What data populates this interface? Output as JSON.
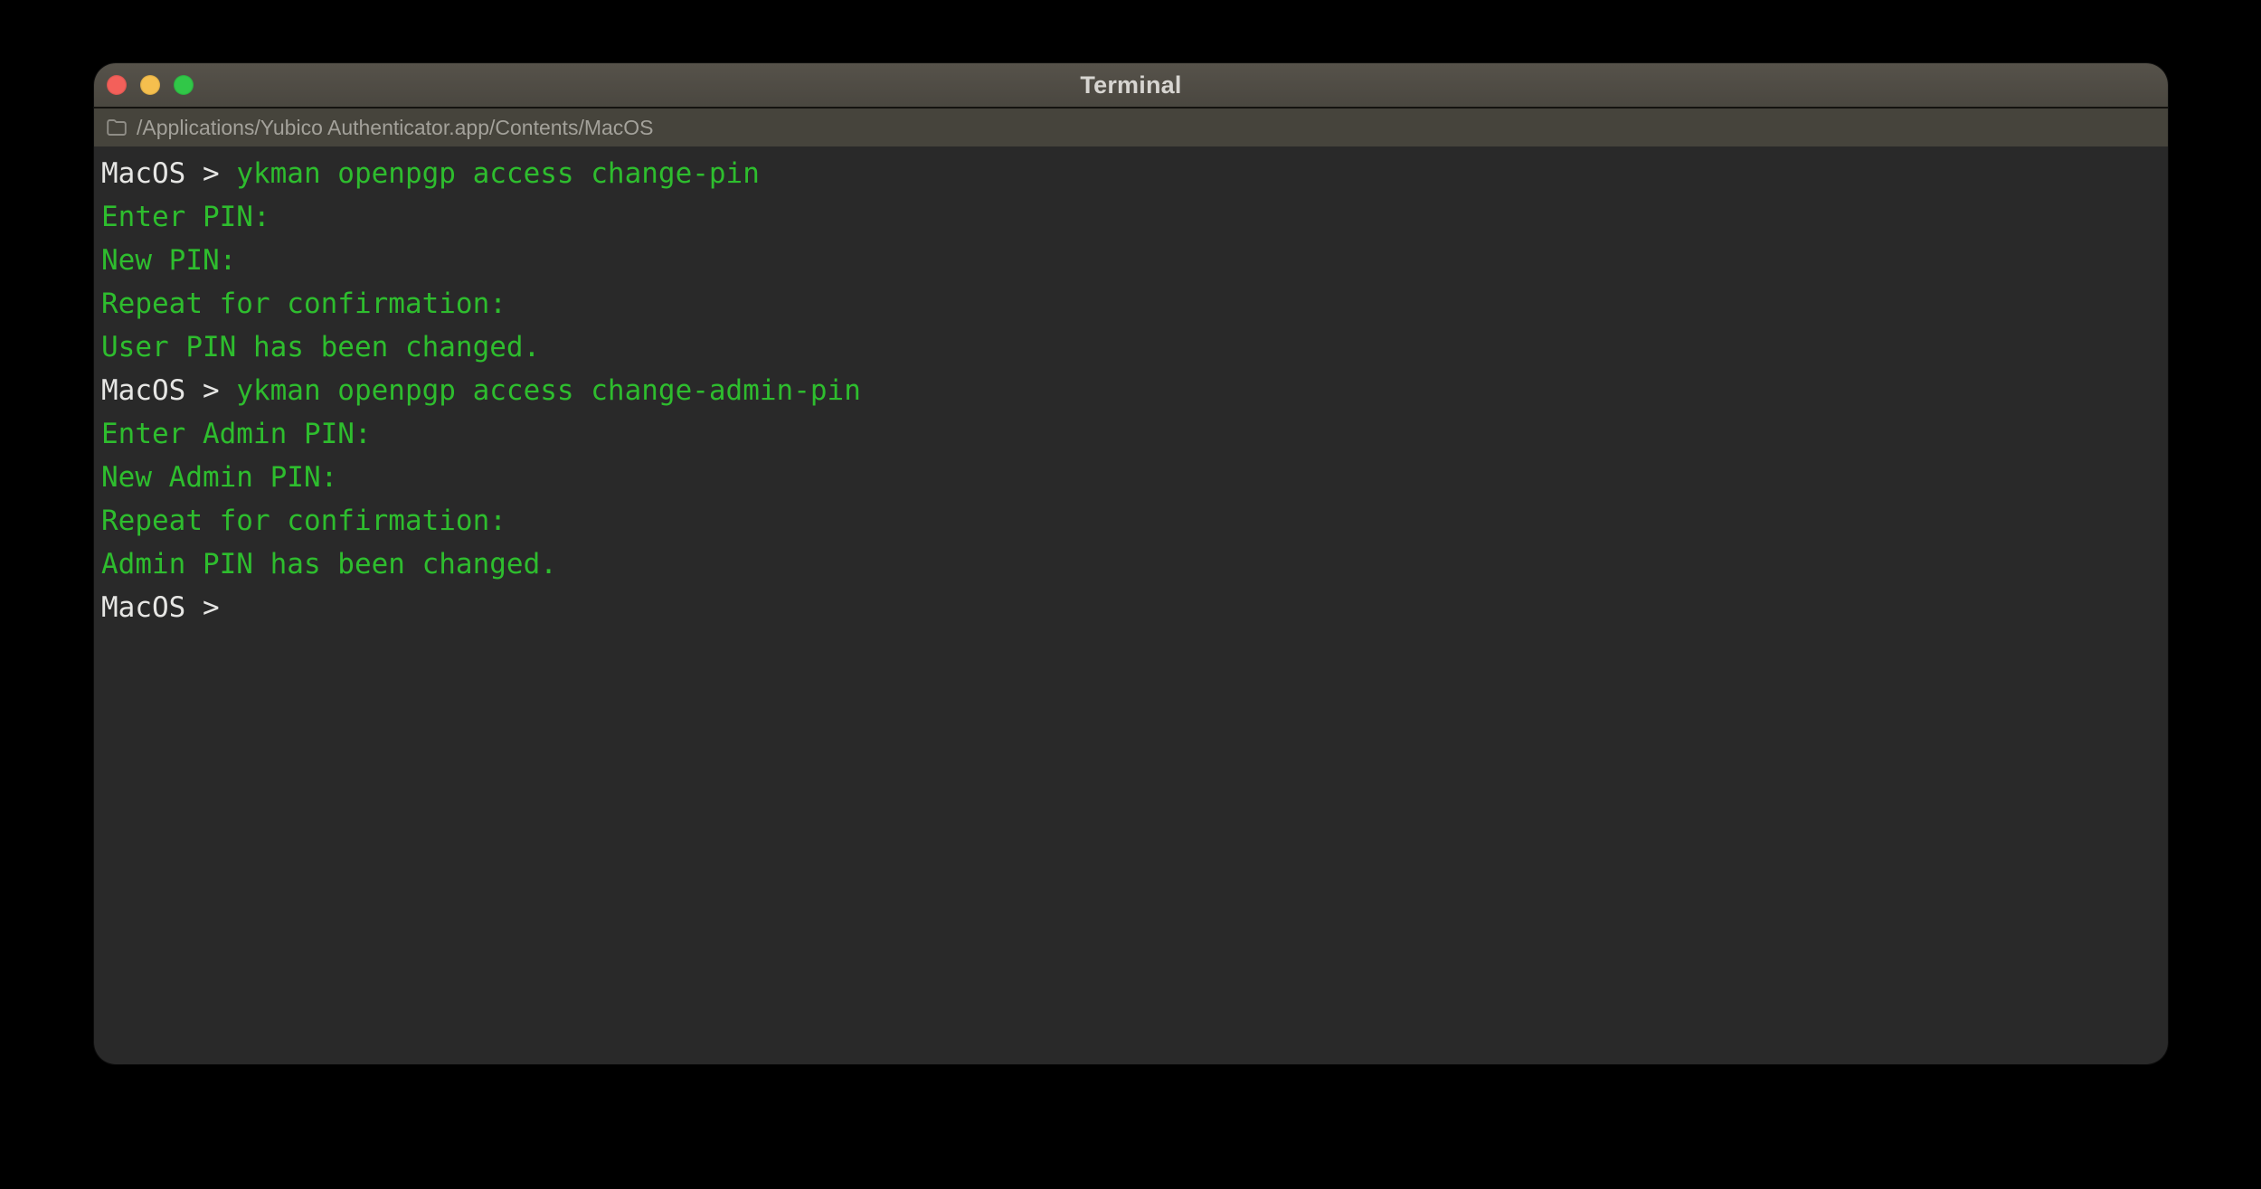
{
  "window": {
    "title": "Terminal"
  },
  "titlebar": {
    "buttons": [
      {
        "name": "close-button"
      },
      {
        "name": "minimize-button"
      },
      {
        "name": "zoom-button"
      }
    ]
  },
  "pathbar": {
    "icon": "folder-icon",
    "path": "/Applications/Yubico Authenticator.app/Contents/MacOS"
  },
  "terminal": {
    "prompt": "MacOS >",
    "lines": [
      {
        "type": "command",
        "prompt": "MacOS >",
        "command": "ykman openpgp access change-pin"
      },
      {
        "type": "output",
        "text": "Enter PIN:"
      },
      {
        "type": "output",
        "text": "New PIN:"
      },
      {
        "type": "output",
        "text": "Repeat for confirmation:"
      },
      {
        "type": "output",
        "text": "User PIN has been changed."
      },
      {
        "type": "command",
        "prompt": "MacOS >",
        "command": "ykman openpgp access change-admin-pin"
      },
      {
        "type": "output",
        "text": "Enter Admin PIN:"
      },
      {
        "type": "output",
        "text": "New Admin PIN:"
      },
      {
        "type": "output",
        "text": "Repeat for confirmation:"
      },
      {
        "type": "output",
        "text": "Admin PIN has been changed."
      },
      {
        "type": "prompt",
        "prompt": "MacOS >"
      }
    ]
  },
  "colors": {
    "page_bg": "#000000",
    "titlebar_top": "#56524a",
    "titlebar_bottom": "#4a4740",
    "pathbar_bg": "#46443c",
    "divider": "#141310",
    "terminal_bg": "#292929",
    "prompt_text": "#e6e6e4",
    "command_green": "#2ebd2e",
    "title_text": "#d7d5d1",
    "path_text": "#a3a19a",
    "traffic_red": "#f3605a",
    "traffic_yellow": "#f5bf4e",
    "traffic_green": "#31c748"
  }
}
